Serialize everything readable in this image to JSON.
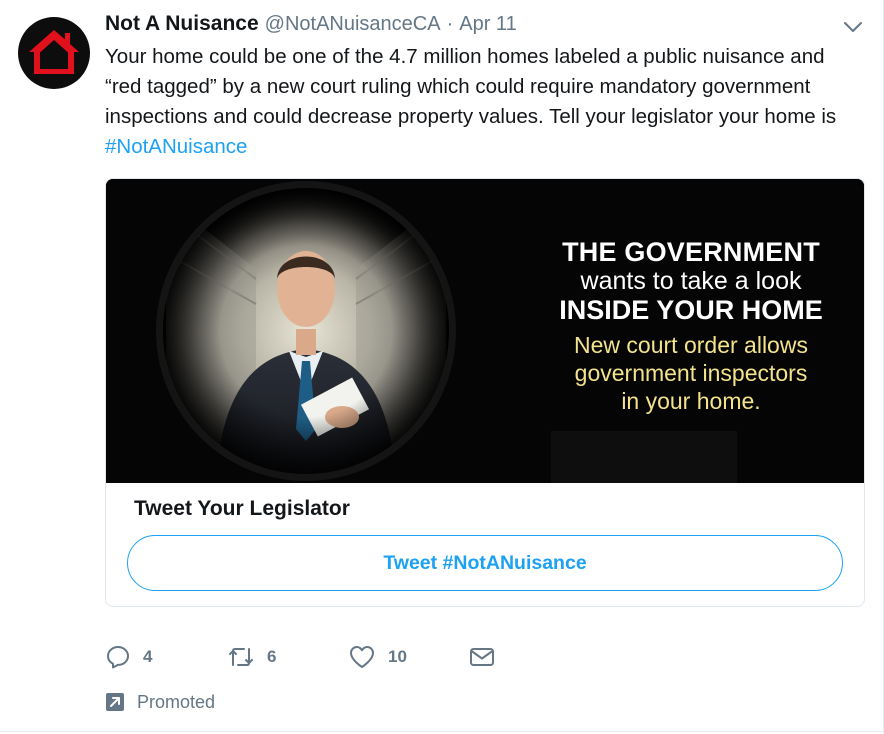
{
  "tweet": {
    "author_name": "Not A Nuisance",
    "author_handle": "@NotANuisanceCA",
    "separator": "·",
    "date": "Apr 11",
    "text_before_hashtag": "Your home could be one of the 4.7 million homes labeled a public nuisance and “red tagged” by a new court ruling which could require mandatory government inspections and could decrease property values. Tell your legislator your home is ",
    "hashtag": "#NotANuisance"
  },
  "card": {
    "image_text": {
      "line1": "THE GOVERNMENT",
      "line2": "wants to take a look",
      "line3": "INSIDE YOUR HOME",
      "sub1": "New court order allows",
      "sub2": "government inspectors",
      "sub3": "in your home."
    },
    "title": "Tweet Your Legislator",
    "button_label": "Tweet #NotANuisance"
  },
  "actions": {
    "reply_count": "4",
    "retweet_count": "6",
    "like_count": "10"
  },
  "promoted_label": "Promoted",
  "colors": {
    "accent": "#1da1f2",
    "muted": "#657786",
    "avatar_house": "#e0101c",
    "ad_subtext": "#f3e38c"
  },
  "icons": {
    "avatar": "red-house-logo",
    "caret": "chevron-down-icon",
    "reply": "reply-icon",
    "retweet": "retweet-icon",
    "like": "heart-icon",
    "message": "envelope-icon",
    "promoted": "promoted-arrow-icon"
  }
}
